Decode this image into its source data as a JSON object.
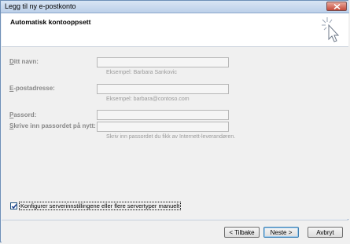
{
  "window": {
    "title": "Legg til ny e-postkonto"
  },
  "header": {
    "heading": "Automatisk kontooppsett"
  },
  "form": {
    "name_label_mnemonic": "D",
    "name_label_rest": "itt navn:",
    "name_hint": "Eksempel: Barbara Sankovic",
    "email_label_mnemonic": "E",
    "email_label_rest": "-postadresse:",
    "email_hint": "Eksempel: barbara@contoso.com",
    "password_label_mnemonic": "P",
    "password_label_rest": "assord:",
    "repeat_label_mnemonic": "S",
    "repeat_label_rest": "krive inn passordet på nytt:",
    "password_hint": "Skriv inn passordet du fikk av Internett-leverandøren."
  },
  "manual_config": {
    "label": "Konfigurer serverinnstillingene eller flere servertyper manuelt",
    "checked": true
  },
  "buttons": {
    "back": "< Tilbake",
    "next": "Neste >",
    "cancel": "Avbryt"
  },
  "colors": {
    "title_gradient_top": "#d8e5f4",
    "close_red": "#c44b3b",
    "disabled_text": "#888888"
  },
  "icons": [
    "close-icon",
    "wizard-cursor-icon",
    "checkmark-icon"
  ]
}
